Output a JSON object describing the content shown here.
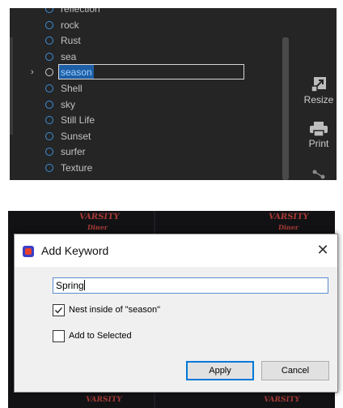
{
  "keywords": {
    "items": [
      {
        "label": "reflection",
        "selected": false
      },
      {
        "label": "rock",
        "selected": false
      },
      {
        "label": "Rust",
        "selected": false
      },
      {
        "label": "sea",
        "selected": false
      },
      {
        "label": "season",
        "selected": true
      },
      {
        "label": "Shell",
        "selected": false
      },
      {
        "label": "sky",
        "selected": false
      },
      {
        "label": "Still Life",
        "selected": false
      },
      {
        "label": "Sunset",
        "selected": false
      },
      {
        "label": "surfer",
        "selected": false
      },
      {
        "label": "Texture",
        "selected": false
      }
    ]
  },
  "side_toolbar": {
    "resize_label": "Resize",
    "print_label": "Print"
  },
  "background_signs": {
    "sign_text": "VARSITY",
    "sign_sub": "Diner"
  },
  "dialog": {
    "title": "Add Keyword",
    "input_value": "Spring",
    "nest_checkbox": {
      "label": "Nest inside of \"season\"",
      "checked": true
    },
    "add_selected_checkbox": {
      "label": "Add to Selected",
      "checked": false
    },
    "apply_label": "Apply",
    "cancel_label": "Cancel"
  },
  "colors": {
    "panel_bg": "#252526",
    "selection": "#1f5fa6",
    "accent_circle": "#3a8fd6",
    "focus_border": "#0078d7"
  }
}
